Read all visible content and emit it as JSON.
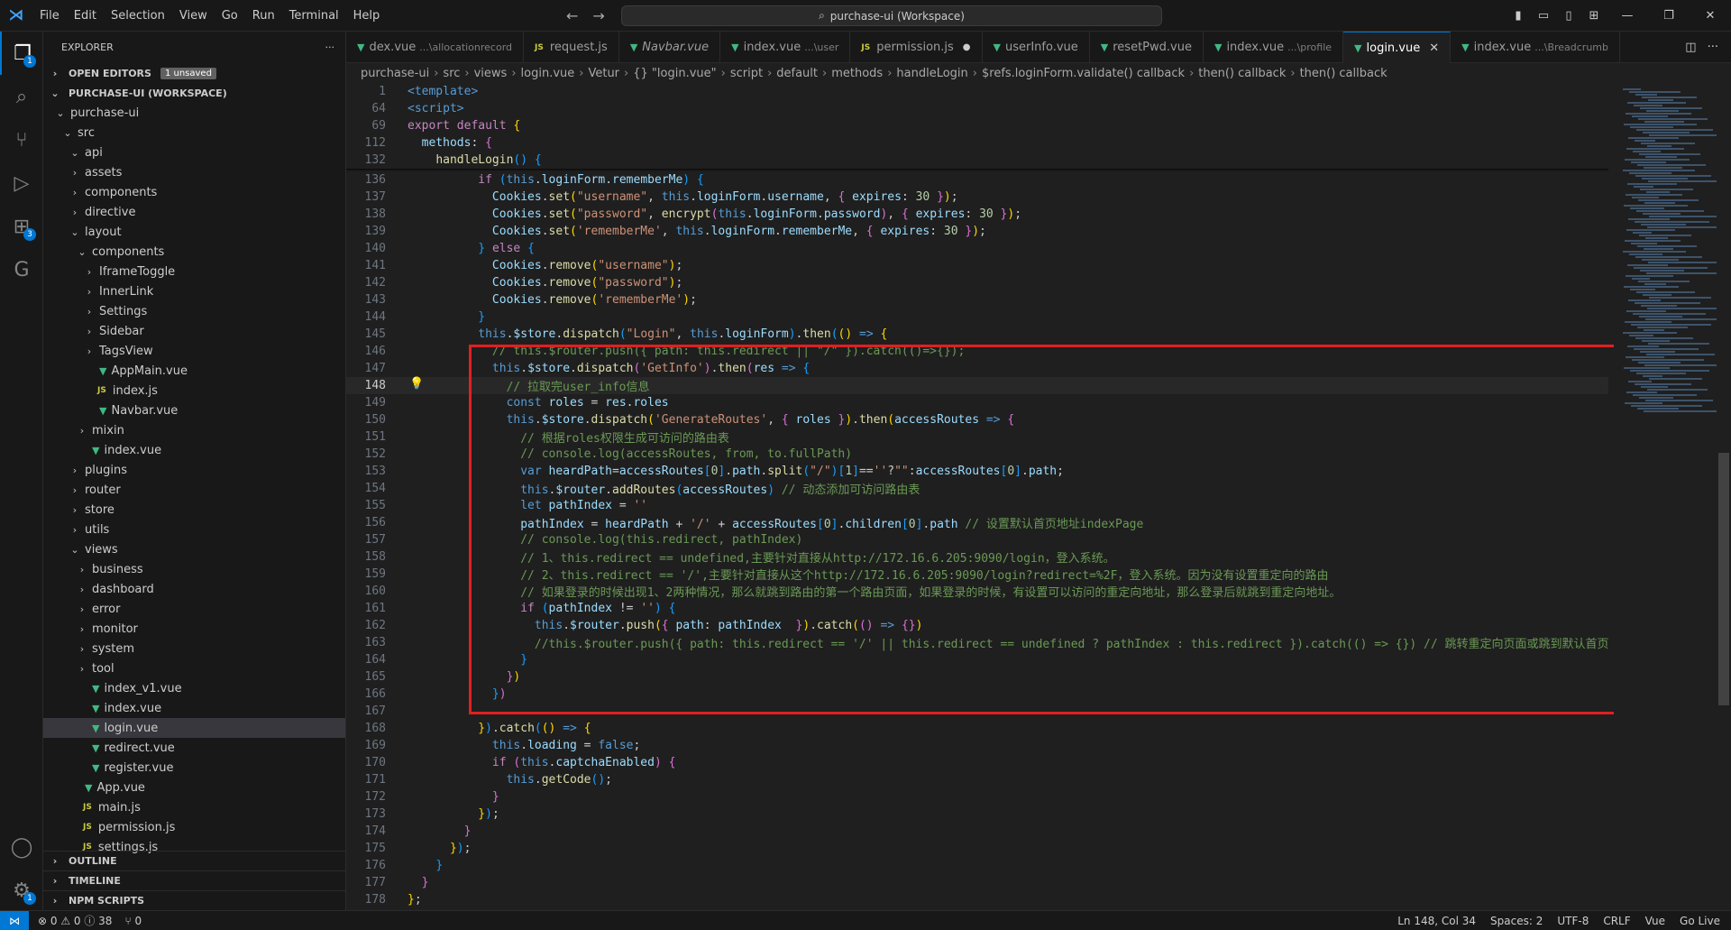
{
  "menu": [
    "File",
    "Edit",
    "Selection",
    "View",
    "Go",
    "Run",
    "Terminal",
    "Help"
  ],
  "search": {
    "text": "purchase-ui (Workspace)"
  },
  "explorer": {
    "title": "EXPLORER",
    "open_editors": "OPEN EDITORS",
    "unsaved": "1 unsaved",
    "workspace": "PURCHASE-UI (WORKSPACE)",
    "tree": [
      {
        "label": "purchase-ui",
        "depth": 1,
        "kind": "open"
      },
      {
        "label": "src",
        "depth": 2,
        "kind": "open"
      },
      {
        "label": "api",
        "depth": 3,
        "kind": "open"
      },
      {
        "label": "assets",
        "depth": 3,
        "kind": "closed"
      },
      {
        "label": "components",
        "depth": 3,
        "kind": "closed"
      },
      {
        "label": "directive",
        "depth": 3,
        "kind": "closed"
      },
      {
        "label": "layout",
        "depth": 3,
        "kind": "open"
      },
      {
        "label": "components",
        "depth": 4,
        "kind": "open"
      },
      {
        "label": "IframeToggle",
        "depth": 5,
        "kind": "closed"
      },
      {
        "label": "InnerLink",
        "depth": 5,
        "kind": "closed"
      },
      {
        "label": "Settings",
        "depth": 5,
        "kind": "closed"
      },
      {
        "label": "Sidebar",
        "depth": 5,
        "kind": "closed"
      },
      {
        "label": "TagsView",
        "depth": 5,
        "kind": "closed"
      },
      {
        "label": "AppMain.vue",
        "depth": 5,
        "kind": "vue"
      },
      {
        "label": "index.js",
        "depth": 5,
        "kind": "js"
      },
      {
        "label": "Navbar.vue",
        "depth": 5,
        "kind": "vue"
      },
      {
        "label": "mixin",
        "depth": 4,
        "kind": "closed"
      },
      {
        "label": "index.vue",
        "depth": 4,
        "kind": "vue"
      },
      {
        "label": "plugins",
        "depth": 3,
        "kind": "closed"
      },
      {
        "label": "router",
        "depth": 3,
        "kind": "closed"
      },
      {
        "label": "store",
        "depth": 3,
        "kind": "closed"
      },
      {
        "label": "utils",
        "depth": 3,
        "kind": "closed"
      },
      {
        "label": "views",
        "depth": 3,
        "kind": "open"
      },
      {
        "label": "business",
        "depth": 4,
        "kind": "closed"
      },
      {
        "label": "dashboard",
        "depth": 4,
        "kind": "closed"
      },
      {
        "label": "error",
        "depth": 4,
        "kind": "closed"
      },
      {
        "label": "monitor",
        "depth": 4,
        "kind": "closed"
      },
      {
        "label": "system",
        "depth": 4,
        "kind": "closed"
      },
      {
        "label": "tool",
        "depth": 4,
        "kind": "closed"
      },
      {
        "label": "index_v1.vue",
        "depth": 4,
        "kind": "vue"
      },
      {
        "label": "index.vue",
        "depth": 4,
        "kind": "vue"
      },
      {
        "label": "login.vue",
        "depth": 4,
        "kind": "vue",
        "selected": true
      },
      {
        "label": "redirect.vue",
        "depth": 4,
        "kind": "vue"
      },
      {
        "label": "register.vue",
        "depth": 4,
        "kind": "vue"
      },
      {
        "label": "App.vue",
        "depth": 3,
        "kind": "vue"
      },
      {
        "label": "main.js",
        "depth": 3,
        "kind": "js"
      },
      {
        "label": "permission.js",
        "depth": 3,
        "kind": "js"
      },
      {
        "label": "settings.js",
        "depth": 3,
        "kind": "js"
      }
    ],
    "outline": "OUTLINE",
    "timeline": "TIMELINE",
    "npm": "NPM SCRIPTS"
  },
  "tabs": [
    {
      "label": "dex.vue",
      "desc": "...\\allocationrecord",
      "icon": "vue"
    },
    {
      "label": "request.js",
      "desc": "",
      "icon": "js"
    },
    {
      "label": "Navbar.vue",
      "desc": "",
      "icon": "vue"
    },
    {
      "label": "index.vue",
      "desc": "...\\user",
      "icon": "vue"
    },
    {
      "label": "permission.js",
      "desc": "",
      "icon": "js",
      "dirty": true
    },
    {
      "label": "userInfo.vue",
      "desc": "",
      "icon": "vue"
    },
    {
      "label": "resetPwd.vue",
      "desc": "",
      "icon": "vue"
    },
    {
      "label": "index.vue",
      "desc": "...\\profile",
      "icon": "vue"
    },
    {
      "label": "login.vue",
      "desc": "",
      "icon": "vue",
      "active": true
    },
    {
      "label": "index.vue",
      "desc": "...\\Breadcrumb",
      "icon": "vue"
    }
  ],
  "breadcrumb": [
    "purchase-ui",
    "src",
    "views",
    "login.vue",
    "Vetur",
    "{} \"login.vue\"",
    "script",
    "default",
    "methods",
    "handleLogin",
    "$refs.loginForm.validate() callback",
    "then() callback",
    "then() callback"
  ],
  "sticky": [
    {
      "n": "1",
      "html": "<span class='tg'>&lt;template&gt;</span>"
    },
    {
      "n": "64",
      "html": "<span class='tg'>&lt;script&gt;</span>"
    },
    {
      "n": "69",
      "html": "<span class='ctl'>export</span> <span class='ctl'>default</span> <span class='br1'>{</span>"
    },
    {
      "n": "112",
      "html": "  <span class='vr'>methods</span><span class='pl'>:</span> <span class='br2'>{</span>"
    },
    {
      "n": "132",
      "html": "    <span class='fn'>handleLogin</span><span class='br3'>()</span> <span class='br3'>{</span>"
    }
  ],
  "code": [
    {
      "n": "136",
      "html": "          <span class='ctl'>if</span> <span class='br3'>(</span><span class='kw'>this</span>.<span class='vr'>loginForm</span>.<span class='vr'>rememberMe</span><span class='br3'>)</span> <span class='br3'>{</span>"
    },
    {
      "n": "137",
      "html": "            <span class='vr'>Cookies</span>.<span class='fn'>set</span><span class='br1'>(</span><span class='st'>\"username\"</span>, <span class='kw'>this</span>.<span class='vr'>loginForm</span>.<span class='vr'>username</span>, <span class='br2'>{</span> <span class='vr'>expires</span>: <span class='nm'>30</span> <span class='br2'>}</span><span class='br1'>)</span>;"
    },
    {
      "n": "138",
      "html": "            <span class='vr'>Cookies</span>.<span class='fn'>set</span><span class='br1'>(</span><span class='st'>\"password\"</span>, <span class='fn'>encrypt</span><span class='br2'>(</span><span class='kw'>this</span>.<span class='vr'>loginForm</span>.<span class='vr'>password</span><span class='br2'>)</span>, <span class='br2'>{</span> <span class='vr'>expires</span>: <span class='nm'>30</span> <span class='br2'>}</span><span class='br1'>)</span>;"
    },
    {
      "n": "139",
      "html": "            <span class='vr'>Cookies</span>.<span class='fn'>set</span><span class='br1'>(</span><span class='st'>'rememberMe'</span>, <span class='kw'>this</span>.<span class='vr'>loginForm</span>.<span class='vr'>rememberMe</span>, <span class='br2'>{</span> <span class='vr'>expires</span>: <span class='nm'>30</span> <span class='br2'>}</span><span class='br1'>)</span>;"
    },
    {
      "n": "140",
      "html": "          <span class='br3'>}</span> <span class='ctl'>else</span> <span class='br3'>{</span>"
    },
    {
      "n": "141",
      "html": "            <span class='vr'>Cookies</span>.<span class='fn'>remove</span><span class='br1'>(</span><span class='st'>\"username\"</span><span class='br1'>)</span>;"
    },
    {
      "n": "142",
      "html": "            <span class='vr'>Cookies</span>.<span class='fn'>remove</span><span class='br1'>(</span><span class='st'>\"password\"</span><span class='br1'>)</span>;"
    },
    {
      "n": "143",
      "html": "            <span class='vr'>Cookies</span>.<span class='fn'>remove</span><span class='br1'>(</span><span class='st'>'rememberMe'</span><span class='br1'>)</span>;"
    },
    {
      "n": "144",
      "html": "          <span class='br3'>}</span>"
    },
    {
      "n": "145",
      "html": "          <span class='kw'>this</span>.<span class='vr'>$store</span>.<span class='fn'>dispatch</span><span class='br3'>(</span><span class='st'>\"Login\"</span>, <span class='kw'>this</span>.<span class='vr'>loginForm</span><span class='br3'>)</span>.<span class='fn'>then</span><span class='br3'>(</span><span class='br1'>()</span> <span class='kw'>=&gt;</span> <span class='br1'>{</span>"
    },
    {
      "n": "146",
      "html": "            <span class='cm'>// this.$router.push({ path: this.redirect || \"/\" }).catch(()=&gt;{});</span>"
    },
    {
      "n": "147",
      "html": "            <span class='kw'>this</span>.<span class='vr'>$store</span>.<span class='fn'>dispatch</span><span class='br2'>(</span><span class='st'>'GetInfo'</span><span class='br2'>)</span>.<span class='fn'>then</span><span class='br2'>(</span><span class='vr'>res</span> <span class='kw'>=&gt;</span> <span class='br3'>{</span>"
    },
    {
      "n": "148",
      "html": "              <span class='cm'>// 拉取完user_info信息</span>",
      "cur": true
    },
    {
      "n": "149",
      "html": "              <span class='kw'>const</span> <span class='vr'>roles</span> = <span class='vr'>res</span>.<span class='vr'>roles</span>"
    },
    {
      "n": "150",
      "html": "              <span class='kw'>this</span>.<span class='vr'>$store</span>.<span class='fn'>dispatch</span><span class='br1'>(</span><span class='st'>'GenerateRoutes'</span>, <span class='br2'>{</span> <span class='vr'>roles</span> <span class='br2'>}</span><span class='br1'>)</span>.<span class='fn'>then</span><span class='br1'>(</span><span class='vr'>accessRoutes</span> <span class='kw'>=&gt;</span> <span class='br2'>{</span>"
    },
    {
      "n": "151",
      "html": "                <span class='cm'>// 根据roles权限生成可访问的路由表</span>"
    },
    {
      "n": "152",
      "html": "                <span class='cm'>// console.log(accessRoutes, from, to.fullPath)</span>"
    },
    {
      "n": "153",
      "html": "                <span class='kw'>var</span> <span class='vr'>heardPath</span>=<span class='vr'>accessRoutes</span><span class='br3'>[</span><span class='nm'>0</span><span class='br3'>]</span>.<span class='vr'>path</span>.<span class='fn'>split</span><span class='br3'>(</span><span class='st'>\"/\"</span><span class='br3'>)</span><span class='br3'>[</span><span class='nm'>1</span><span class='br3'>]</span>==<span class='st'>''</span>?<span class='st'>\"\"</span>:<span class='vr'>accessRoutes</span><span class='br3'>[</span><span class='nm'>0</span><span class='br3'>]</span>.<span class='vr'>path</span>;"
    },
    {
      "n": "154",
      "html": "                <span class='kw'>this</span>.<span class='vr'>$router</span>.<span class='fn'>addRoutes</span><span class='br3'>(</span><span class='vr'>accessRoutes</span><span class='br3'>)</span> <span class='cm'>// 动态添加可访问路由表</span>"
    },
    {
      "n": "155",
      "html": "                <span class='kw'>let</span> <span class='vr'>pathIndex</span> = <span class='st'>''</span>"
    },
    {
      "n": "156",
      "html": "                <span class='vr'>pathIndex</span> = <span class='vr'>heardPath</span> + <span class='st'>'/'</span> + <span class='vr'>accessRoutes</span><span class='br3'>[</span><span class='nm'>0</span><span class='br3'>]</span>.<span class='vr'>children</span><span class='br3'>[</span><span class='nm'>0</span><span class='br3'>]</span>.<span class='vr'>path</span> <span class='cm'>// 设置默认首页地址indexPage</span>"
    },
    {
      "n": "157",
      "html": "                <span class='cm'>// console.log(this.redirect, pathIndex)</span>"
    },
    {
      "n": "158",
      "html": "                <span class='cm'>// 1、this.redirect == undefined,主要针对直接从http://172.16.6.205:9090/login，登入系统。</span>"
    },
    {
      "n": "159",
      "html": "                <span class='cm'>// 2、this.redirect == '/',主要针对直接从这个http://172.16.6.205:9090/login?redirect=%2F，登入系统。因为没有设置重定向的路由</span>"
    },
    {
      "n": "160",
      "html": "                <span class='cm'>// 如果登录的时候出现1、2两种情况，那么就跳到路由的第一个路由页面，如果登录的时候，有设置可以访问的重定向地址，那么登录后就跳到重定向地址。</span>"
    },
    {
      "n": "161",
      "html": "                <span class='ctl'>if</span> <span class='br3'>(</span><span class='vr'>pathIndex</span> != <span class='st'>''</span><span class='br3'>)</span> <span class='br3'>{</span>"
    },
    {
      "n": "162",
      "html": "                  <span class='kw'>this</span>.<span class='vr'>$router</span>.<span class='fn'>push</span><span class='br1'>(</span><span class='br2'>{</span> <span class='vr'>path</span>: <span class='vr'>pathIndex</span>  <span class='br2'>}</span><span class='br1'>)</span>.<span class='fn'>catch</span><span class='br1'>(</span><span class='br2'>()</span> <span class='kw'>=&gt;</span> <span class='br2'>{}</span><span class='br1'>)</span>"
    },
    {
      "n": "163",
      "html": "                  <span class='cm'>//this.$router.push({ path: this.redirect == '/' || this.redirect == undefined ? pathIndex : this.redirect }).catch(() =&gt; {}) // 跳转重定向页面或跳到默认首页</span>"
    },
    {
      "n": "164",
      "html": "                <span class='br3'>}</span>"
    },
    {
      "n": "165",
      "html": "              <span class='br2'>}</span><span class='br1'>)</span>"
    },
    {
      "n": "166",
      "html": "            <span class='br3'>}</span><span class='br2'>)</span>"
    },
    {
      "n": "167",
      "html": ""
    },
    {
      "n": "168",
      "html": "          <span class='br1'>}</span><span class='br3'>)</span>.<span class='fn'>catch</span><span class='br3'>(</span><span class='br1'>()</span> <span class='kw'>=&gt;</span> <span class='br1'>{</span>"
    },
    {
      "n": "169",
      "html": "            <span class='kw'>this</span>.<span class='vr'>loading</span> = <span class='kw'>false</span>;"
    },
    {
      "n": "170",
      "html": "            <span class='ctl'>if</span> <span class='br2'>(</span><span class='kw'>this</span>.<span class='vr'>captchaEnabled</span><span class='br2'>)</span> <span class='br2'>{</span>"
    },
    {
      "n": "171",
      "html": "              <span class='kw'>this</span>.<span class='fn'>getCode</span><span class='br3'>()</span>;"
    },
    {
      "n": "172",
      "html": "            <span class='br2'>}</span>"
    },
    {
      "n": "173",
      "html": "          <span class='br1'>}</span><span class='br3'>)</span>;"
    },
    {
      "n": "174",
      "html": "        <span class='br2'>}</span>"
    },
    {
      "n": "175",
      "html": "      <span class='br1'>}</span><span class='br3'>)</span>;"
    },
    {
      "n": "176",
      "html": "    <span class='br3'>}</span>"
    },
    {
      "n": "177",
      "html": "  <span class='br2'>}</span>"
    },
    {
      "n": "178",
      "html": "<span class='br1'>}</span>;"
    }
  ],
  "status": {
    "problems": "⊗ 0 ⚠ 0 ⓘ 38",
    "ports": "⑂ 0",
    "position": "Ln 148, Col 34",
    "spaces": "Spaces: 2",
    "encoding": "UTF-8",
    "eol": "CRLF",
    "language": "Vue",
    "golive": "Go Live"
  },
  "colors": {
    "accent": "#0078d4",
    "highlight_box": "#e02020"
  }
}
